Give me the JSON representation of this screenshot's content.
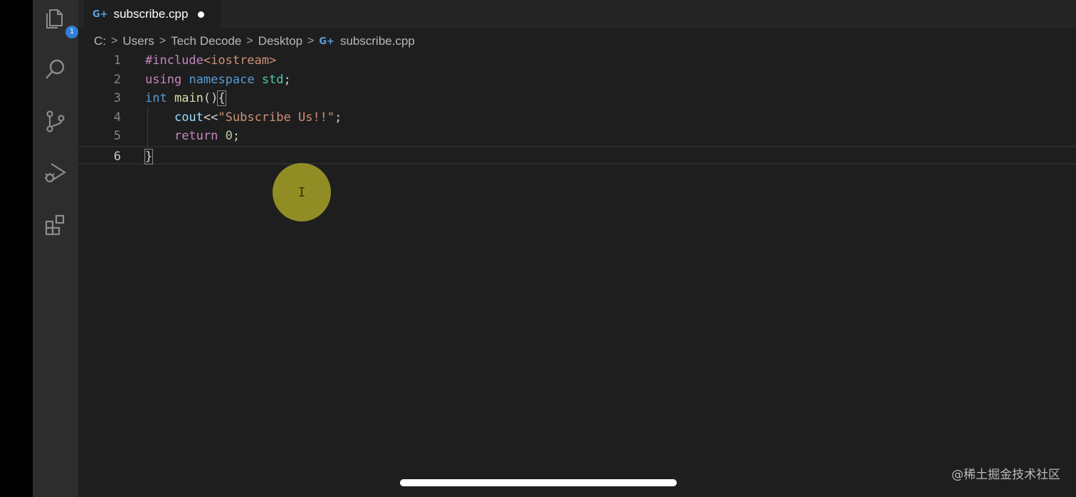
{
  "tabs": [
    {
      "label": "subscribe.cpp",
      "icon": "cpp-file-icon",
      "icon_glyph": "G+",
      "modified": true
    }
  ],
  "breadcrumb": {
    "items": [
      "C:",
      "Users",
      "Tech Decode",
      "Desktop"
    ],
    "file": "subscribe.cpp",
    "file_icon_glyph": "G+",
    "separator": ">"
  },
  "activity_bar": {
    "items": [
      "explorer-icon",
      "search-icon",
      "source-control-icon",
      "run-debug-icon",
      "extensions-icon"
    ],
    "explorer_badge": "1"
  },
  "editor": {
    "active_line": 6,
    "lines": [
      {
        "num": "1",
        "tokens": [
          [
            "#include",
            "dir"
          ],
          [
            "<iostream>",
            "inc"
          ]
        ]
      },
      {
        "num": "2",
        "tokens": [
          [
            "using",
            "kw"
          ],
          [
            " ",
            "punc"
          ],
          [
            "namespace",
            "ns"
          ],
          [
            " ",
            "punc"
          ],
          [
            "std",
            "id"
          ],
          [
            ";",
            "punc"
          ]
        ]
      },
      {
        "num": "3",
        "tokens": [
          [
            "int",
            "type"
          ],
          [
            " ",
            "punc"
          ],
          [
            "main",
            "fn"
          ],
          [
            "()",
            "punc"
          ],
          [
            "{",
            "punc"
          ]
        ]
      },
      {
        "num": "4",
        "tokens": [
          [
            "    ",
            "punc"
          ],
          [
            "cout",
            "var"
          ],
          [
            "<<",
            "op"
          ],
          [
            "\"Subscribe Us!!\"",
            "str"
          ],
          [
            ";",
            "punc"
          ]
        ]
      },
      {
        "num": "5",
        "tokens": [
          [
            "    ",
            "punc"
          ],
          [
            "return",
            "kw"
          ],
          [
            " ",
            "punc"
          ],
          [
            "0",
            "num"
          ],
          [
            ";",
            "punc"
          ]
        ]
      },
      {
        "num": "6",
        "tokens": [
          [
            "}",
            "punc"
          ]
        ]
      }
    ]
  },
  "cursor": {
    "glyph": "I"
  },
  "watermark": "@稀土掘金技术社区",
  "colors": {
    "activity_bar": "#2d2d2d",
    "editor_bg": "#1e1e1e",
    "tabbar_bg": "#252526",
    "badge": "#2f7fd6",
    "cursor_halo": "#bebb28"
  }
}
